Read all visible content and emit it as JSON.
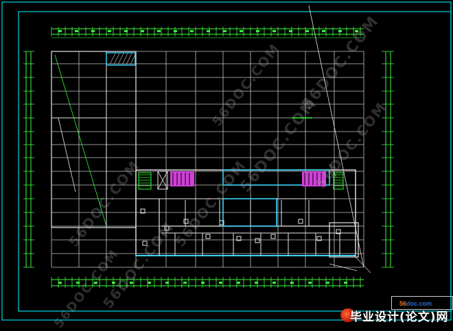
{
  "drawing": {
    "type": "CAD floor plan",
    "colors": {
      "background": "#000000",
      "frame": "#00d8e8",
      "grid": "#c8c8c8",
      "dimension": "#3cff3c",
      "wall": "#e8e8e8",
      "cyan_wall": "#3ad7ff",
      "stair_fill": "#d040d8",
      "accent_green": "#2cff2c"
    }
  },
  "watermarks": [
    "56DOC.COM",
    "56DOC.COM",
    "56DOC.COM",
    "56DOC.COM",
    "56DOC.COM",
    "56DOC.COM",
    "56DOC.COM",
    "56DOC.COM"
  ],
  "logo": {
    "site_prefix": "56",
    "site_suffix": "doc.com",
    "title": "毕业设计(论文)网"
  }
}
